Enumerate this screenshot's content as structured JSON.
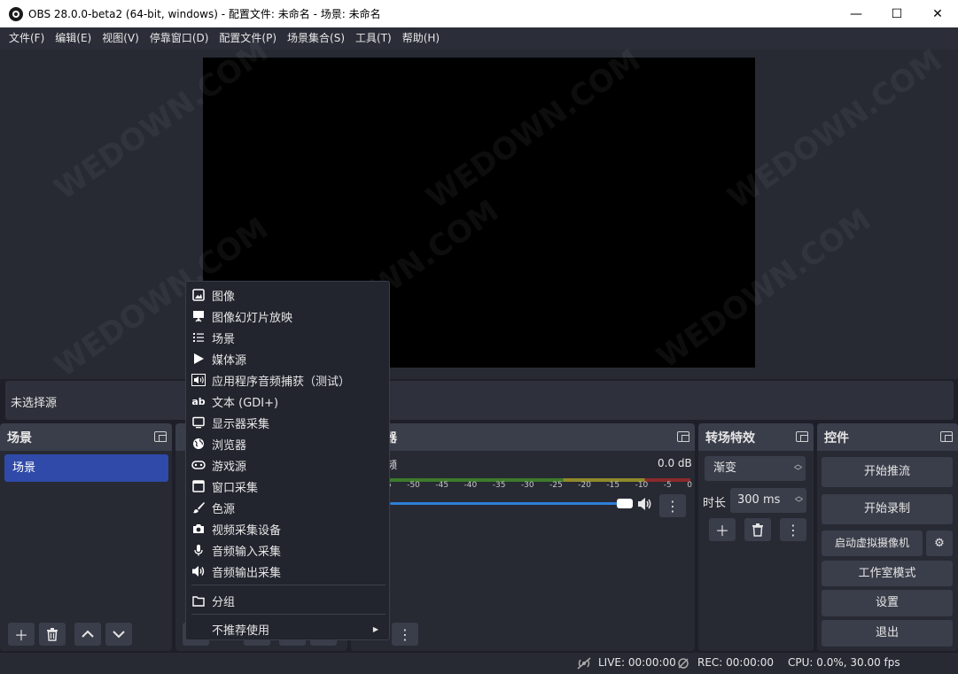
{
  "window": {
    "title": "OBS 28.0.0-beta2 (64-bit, windows) - 配置文件: 未命名 - 场景: 未命名",
    "minimize": "—",
    "maximize": "☐",
    "close": "✕"
  },
  "menu": [
    "文件(F)",
    "编辑(E)",
    "视图(V)",
    "停靠窗口(D)",
    "配置文件(P)",
    "场景集合(S)",
    "工具(T)",
    "帮助(H)"
  ],
  "source_bar": {
    "text": "未选择源"
  },
  "scenes": {
    "title": "场景",
    "items": [
      "场景"
    ]
  },
  "mixer": {
    "title": "器",
    "channel": "频",
    "level": "0.0 dB",
    "scale": [
      "5",
      "-50",
      "-45",
      "-40",
      "-35",
      "-30",
      "-25",
      "-20",
      "-15",
      "-10",
      "-5",
      "0"
    ],
    "volume_fraction": 0.96
  },
  "transitions": {
    "title": "转场特效",
    "selected": "渐变",
    "duration_label": "时长",
    "duration_value": "300 ms"
  },
  "controls": {
    "title": "控件",
    "buttons": [
      "开始推流",
      "开始录制",
      "启动虚拟摄像机",
      "工作室模式",
      "设置",
      "退出"
    ]
  },
  "status": {
    "live": "LIVE: 00:00:00",
    "rec": "REC: 00:00:00",
    "cpu": "CPU: 0.0%, 30.00 fps"
  },
  "context_menu": {
    "items": [
      {
        "label": "图像",
        "icon": "image-icon"
      },
      {
        "label": "图像幻灯片放映",
        "icon": "slideshow-icon"
      },
      {
        "label": "场景",
        "icon": "list-icon"
      },
      {
        "label": "媒体源",
        "icon": "play-icon"
      },
      {
        "label": "应用程序音频捕获（测试）",
        "icon": "app-audio-icon"
      },
      {
        "label": "文本 (GDI+)",
        "icon": "text-icon"
      },
      {
        "label": "显示器采集",
        "icon": "monitor-icon"
      },
      {
        "label": "浏览器",
        "icon": "globe-icon"
      },
      {
        "label": "游戏源",
        "icon": "gamepad-icon"
      },
      {
        "label": "窗口采集",
        "icon": "window-icon"
      },
      {
        "label": "色源",
        "icon": "brush-icon"
      },
      {
        "label": "视频采集设备",
        "icon": "camera-icon"
      },
      {
        "label": "音频输入采集",
        "icon": "microphone-icon"
      },
      {
        "label": "音频输出采集",
        "icon": "speaker-icon"
      }
    ],
    "group": {
      "label": "分组",
      "icon": "folder-icon"
    },
    "deprecated": {
      "label": "不推荐使用",
      "icon": "submenu-arrow-icon"
    }
  },
  "watermark": "WEDOWN.COM"
}
